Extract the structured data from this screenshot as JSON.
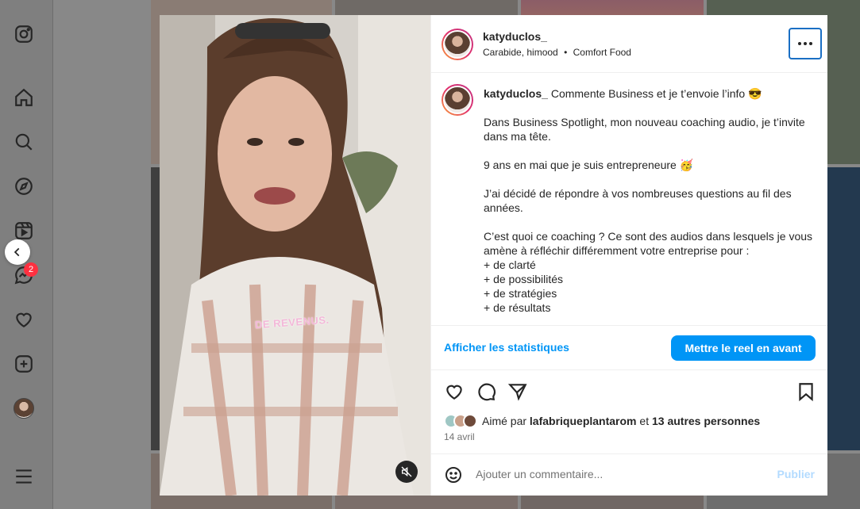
{
  "post": {
    "username": "katyduclos_",
    "audio_artist": "Carabide, himood",
    "separator": "•",
    "audio_track": "Comfort Food",
    "caption_username": "katyduclos_",
    "caption_first": "Commente Business et je t’envoie l’info 😎",
    "paragraphs": [
      "Dans Business Spotlight, mon nouveau coaching audio, je t’invite dans ma tête.",
      "9 ans en mai que je suis entrepreneure 🥳",
      "J’ai décidé de répondre à vos nombreuses questions au fil des années."
    ],
    "para4_intro": "C’est quoi ce coaching ? Ce sont des audios dans lesquels je vous amène à réfléchir différemment votre entreprise pour :",
    "bullets": [
      "+ de clarté",
      "+ de possibilités",
      "+ de stratégies",
      "+ de résultats"
    ],
    "video_overlay": "DE REVENUS."
  },
  "insights": {
    "stats_link": "Afficher les statistiques",
    "boost_button": "Mettre le reel en avant"
  },
  "engagement": {
    "liked_prefix": "Aimé par",
    "liked_user": "lafabriqueplantarom",
    "liked_and": "et",
    "liked_others": "13 autres personnes",
    "date": "14 avril"
  },
  "comment": {
    "placeholder": "Ajouter un commentaire...",
    "publish": "Publier"
  },
  "nav": {
    "message_badge": "2"
  }
}
